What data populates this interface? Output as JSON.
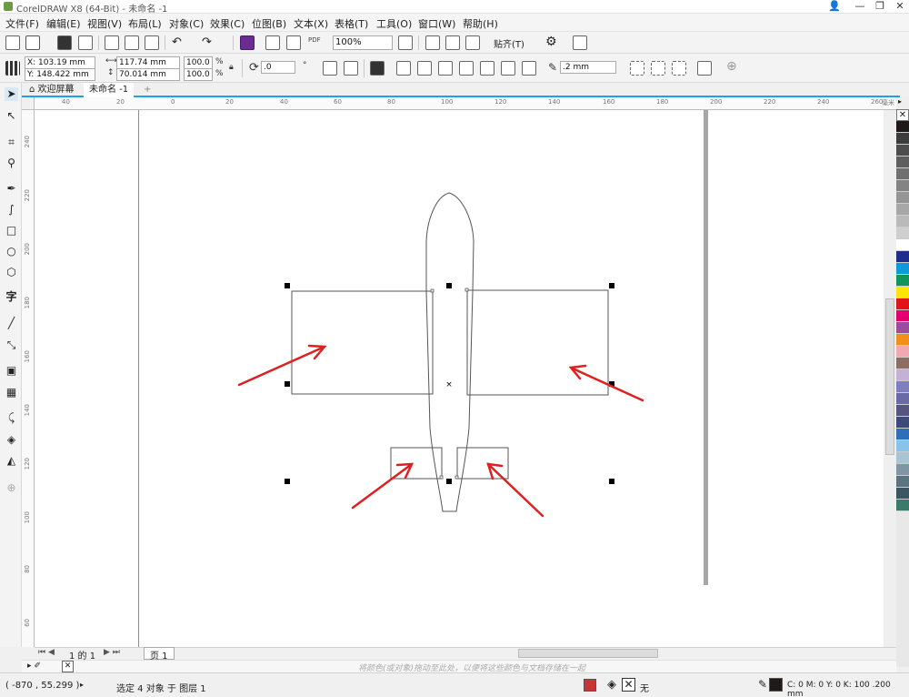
{
  "window": {
    "title": "CorelDRAW X8 (64-Bit) - 未命名 -1",
    "minimize": "—",
    "restore": "❐",
    "close": "✕"
  },
  "menu": [
    "文件(F)",
    "编辑(E)",
    "视图(V)",
    "布局(L)",
    "对象(C)",
    "效果(C)",
    "位图(B)",
    "文本(X)",
    "表格(T)",
    "工具(O)",
    "窗口(W)",
    "帮助(H)"
  ],
  "toolbar1": {
    "zoom": "100%",
    "snap": "贴齐(T)",
    "pdf": "PDF"
  },
  "propbar": {
    "x": "X: 103.19 mm",
    "y": "Y: 148.422 mm",
    "w": "117.74 mm",
    "h": "70.014 mm",
    "sx": "100.0",
    "sy": "100.0",
    "pct1": "%",
    "pct2": "%",
    "angle": ".0",
    "deg": "°",
    "outline": ".2 mm"
  },
  "tabs": {
    "welcome": "欢迎屏幕",
    "doc": "未命名 -1",
    "add": "+"
  },
  "hruler": [
    "40",
    "20",
    "0",
    "20",
    "40",
    "60",
    "80",
    "100",
    "120",
    "140",
    "160",
    "180",
    "200",
    "220",
    "240",
    "260",
    "毫米"
  ],
  "vruler": [
    "240",
    "220",
    "200",
    "180",
    "160",
    "140",
    "120",
    "100",
    "80",
    "60"
  ],
  "pagenav": {
    "pages": "1 的 1",
    "page": "页 1"
  },
  "hint": "将颜色(或对象)拖动至此处，以便将这些颜色与文档存储在一起",
  "status": {
    "coords": "( -870 , 55.299 )",
    "selection": "选定 4 对象 于 图层 1",
    "fill_none": "无",
    "outline_info": "C: 0 M: 0 Y: 0 K: 100  .200 mm"
  },
  "colors": {
    "accent": "#1aa3e6",
    "arrow": "#e02020",
    "palette": [
      "#1f1a17",
      "#3c3c3c",
      "#4d4d4d",
      "#5e5e5e",
      "#707070",
      "#838383",
      "#959595",
      "#a7a7a7",
      "#bababa",
      "#cecece",
      "#ffffff",
      "#1d2c8c",
      "#0c9ad8",
      "#12955a",
      "#ffe600",
      "#e2141b",
      "#e4006e",
      "#9b4c9e",
      "#f28e1a",
      "#f2a8b0",
      "#8d6e63",
      "#c5b0d6",
      "#7f7fbf",
      "#6a6aa6",
      "#55557f",
      "#3e4a78",
      "#2f6fba",
      "#88c4e8",
      "#a9c5d3",
      "#7f97a4",
      "#5c7380",
      "#3b5563",
      "#3a7a6a"
    ]
  },
  "icons": [
    "select-tool-icon",
    "shape-tool-icon",
    "crop-tool-icon",
    "zoom-tool-icon",
    "freehand-tool-icon",
    "bezier-tool-icon",
    "rectangle-tool-icon",
    "ellipse-tool-icon",
    "polygon-tool-icon",
    "text-tool-icon",
    "line-tool-icon",
    "connector-tool-icon",
    "shadow-tool-icon",
    "transparency-tool-icon",
    "eyedropper-tool-icon",
    "fill-tool-icon",
    "smart-fill-tool-icon",
    "add-tool-icon"
  ]
}
